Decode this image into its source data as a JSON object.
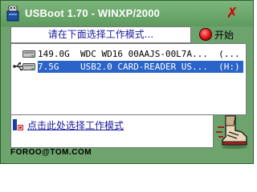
{
  "window": {
    "title": "USBoot 1.70 - WINXP/2000",
    "close_symbol": "✗"
  },
  "prompt": {
    "text": "请在下面选择工作模式..."
  },
  "start_button": {
    "label": "开始",
    "icon": "red-circle-icon"
  },
  "drives": [
    {
      "icon": "hard-disk-icon",
      "text": "149.0G  WDC WD16 00AAJS-00L7A...  (...",
      "selected": false
    },
    {
      "icon": "usb-drive-icon",
      "text": "7.5G    USB2.0 CARD-READER US...  (H:)",
      "selected": true
    }
  ],
  "mode_link": {
    "text": "点击此处选择工作模式"
  },
  "footer": {
    "email": "FOROO@TOM.COM"
  },
  "colors": {
    "frame": "#6da46d",
    "title_text": "#ffffff",
    "close": "#d00000",
    "prompt_text": "#1a1a9c",
    "selection": "#2a64c8"
  }
}
